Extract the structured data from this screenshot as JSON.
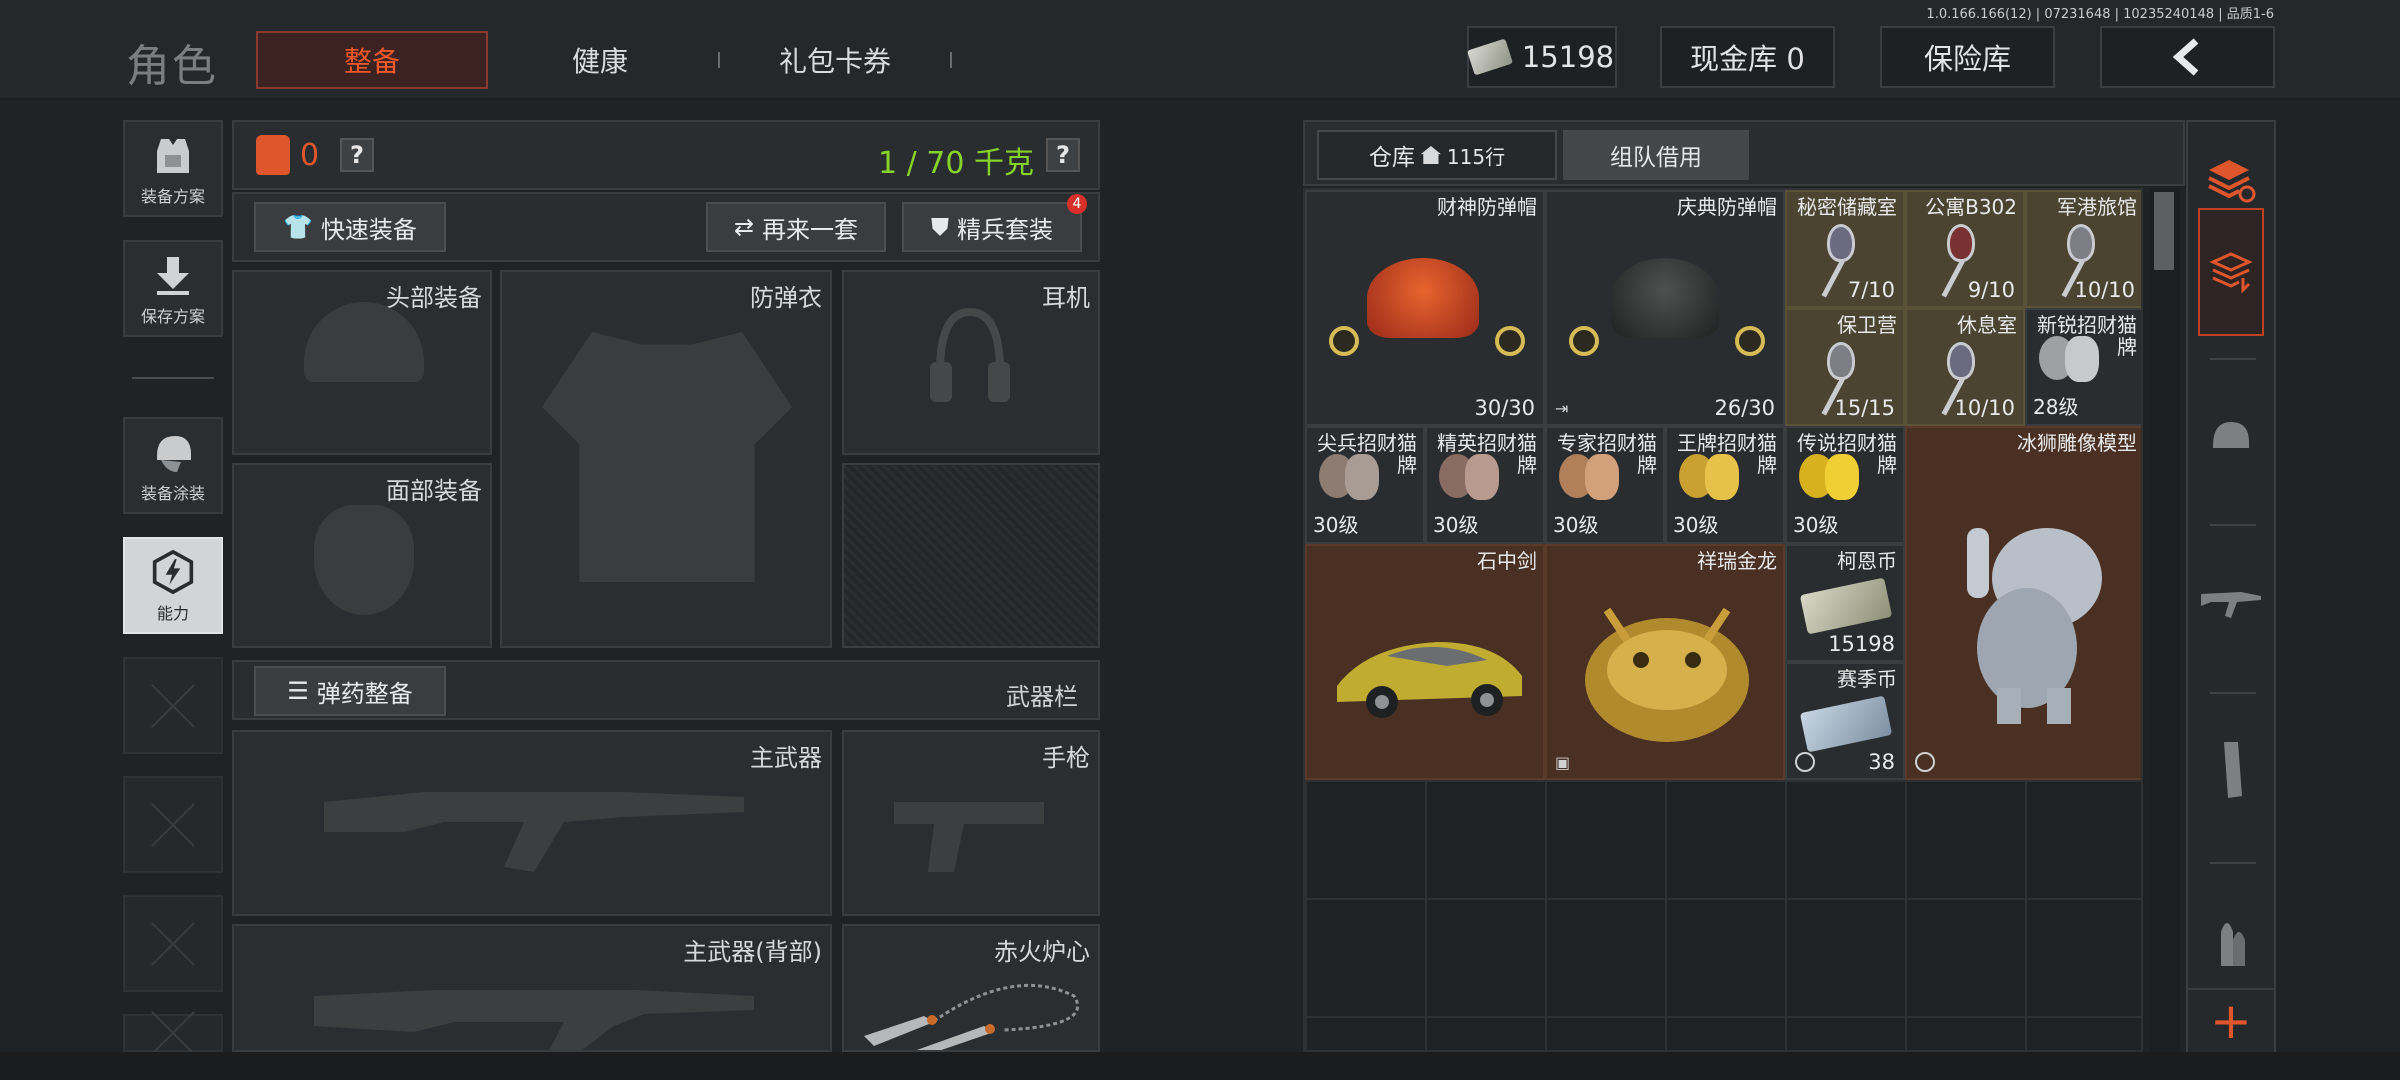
{
  "version": "1.0.166.166(12) | 07231648 | 10235240148 | 品质1-6",
  "header": {
    "brand": "角色",
    "tabs": [
      "整备",
      "健康",
      "礼包卡券"
    ],
    "money": "15198",
    "cash_vault": "现金库 0",
    "insured": "保险库",
    "back_icon": "chevron-left-icon"
  },
  "side_nav": {
    "items": [
      "装备方案",
      "保存方案",
      "装备涂装",
      "能力"
    ]
  },
  "equipment": {
    "vest_count": "0",
    "help": "?",
    "weight": "1 / 70 千克",
    "quick_equip": "快速装备",
    "again": "再来一套",
    "elite": "精兵套装",
    "elite_badge": "4",
    "slots": {
      "head": "头部装备",
      "armor": "防弹衣",
      "earphone": "耳机",
      "face": "面部装备",
      "primary": "主武器",
      "pistol": "手枪",
      "primary_back": "主武器(背部)",
      "melee": "赤火炉心"
    },
    "ammo": "弹药整备",
    "weapon_bar": "武器栏"
  },
  "storage": {
    "tab_warehouse": "仓库",
    "warehouse_rows": "115行",
    "tab_team": "组队借用",
    "items": [
      {
        "name": "财神防弹帽",
        "qty": "30/30"
      },
      {
        "name": "庆典防弹帽",
        "qty": "26/30"
      },
      {
        "name": "秘密储藏室",
        "qty": "7/10"
      },
      {
        "name": "公寓B302",
        "qty": "9/10"
      },
      {
        "name": "军港旅馆",
        "qty": "10/10"
      },
      {
        "name": "保卫营",
        "qty": "15/15"
      },
      {
        "name": "休息室",
        "qty": "10/10"
      },
      {
        "name": "新锐招财猫\n牌",
        "level": "28级"
      },
      {
        "name": "尖兵招财猫\n牌",
        "level": "30级"
      },
      {
        "name": "精英招财猫\n牌",
        "level": "30级"
      },
      {
        "name": "专家招财猫\n牌",
        "level": "30级"
      },
      {
        "name": "王牌招财猫\n牌",
        "level": "30级"
      },
      {
        "name": "传说招财猫\n牌",
        "level": "30级"
      },
      {
        "name": "冰狮雕像模型"
      },
      {
        "name": "石中剑"
      },
      {
        "name": "祥瑞金龙"
      },
      {
        "name": "柯恩币",
        "qty": "15198"
      },
      {
        "name": "赛季币",
        "qty": "38"
      }
    ]
  },
  "rail": {
    "icons": [
      "layers-refresh-icon",
      "storage-active-icon",
      "helmet-icon",
      "rifle-icon",
      "magazine-icon",
      "bullets-icon"
    ],
    "plus": "+"
  },
  "colors": {
    "accent": "#e0562c",
    "weight_green": "#86d42a",
    "badge_red": "#d7302a"
  }
}
